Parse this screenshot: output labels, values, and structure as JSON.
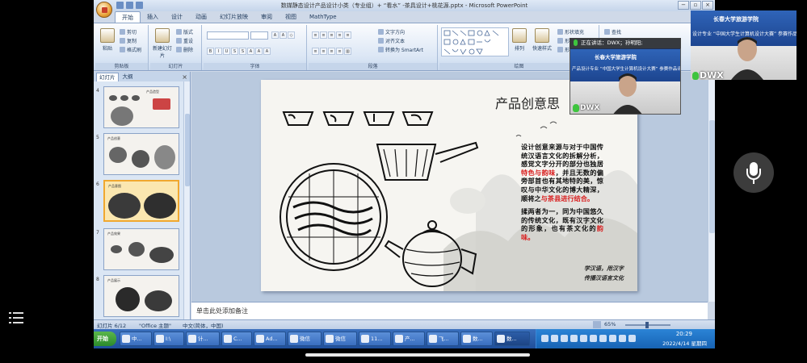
{
  "window": {
    "title": "数媒静态设计产品设计小类（专业组）+ “看水” -茶具设计+桃花源.pptx - Microsoft PowerPoint",
    "controls": [
      "−",
      "▫",
      "×"
    ]
  },
  "ribbon": {
    "tabs": [
      "开始",
      "插入",
      "设计",
      "动画",
      "幻灯片放映",
      "审阅",
      "视图",
      "MathType"
    ],
    "active_tab": "开始",
    "groups": {
      "clipboard": {
        "label": "剪贴板",
        "paste": "粘贴",
        "cut": "剪切",
        "copy": "复制",
        "format_painter": "格式刷"
      },
      "slides": {
        "label": "幻灯片",
        "new_slide": "新建幻灯片",
        "layout": "版式",
        "reset": "重设",
        "delete": "删除"
      },
      "font": {
        "label": "字体"
      },
      "paragraph": {
        "label": "段落",
        "text_direction": "文字方向",
        "align_text": "对齐文本",
        "smartart": "转换为 SmartArt"
      },
      "drawing": {
        "label": "绘图",
        "arrange": "排列",
        "quick_styles": "快速样式",
        "shape_fill": "形状填充",
        "shape_outline": "形状轮廓",
        "shape_effects": "形状效果"
      },
      "editing": {
        "find": "查找"
      }
    }
  },
  "slides_pane": {
    "tabs": [
      "幻灯片",
      "大纲"
    ],
    "close": "×",
    "thumbnails": [
      {
        "num": "4",
        "title": "产品造型",
        "selected": false
      },
      {
        "num": "5",
        "title": "产品创意",
        "selected": false
      },
      {
        "num": "6",
        "title": "产品意图",
        "selected": true
      },
      {
        "num": "7",
        "title": "产品效果",
        "selected": false
      },
      {
        "num": "8",
        "title": "产品展示",
        "selected": false
      }
    ]
  },
  "slide": {
    "title": "产品创意思",
    "body": {
      "p1_a": "设计创意来源与对于中国传统汉语言文化的拆解分析，感觉文字分开的部分也独居",
      "p1_red1": "特色与韵味",
      "p1_b": "，并且无数的偏旁部首也有其地特的美，惊叹与中华文化的博大精深，顺将之",
      "p1_red2": "与茶县进行结合。",
      "p2_a": "揉两者为一，同为中国悠久的传统文化，既有汉字文化的形象，也有茶文化的",
      "p2_red": "韵味。"
    },
    "slogan_line1": "学汉语，用汉字",
    "slogan_line2": "传播汉语言文化"
  },
  "notes": {
    "placeholder": "单击此处添加备注"
  },
  "statusbar": {
    "slide_counter": "幻灯片 6/12",
    "theme": "\"Office 主题\"",
    "language": "中文(简体，中国)",
    "zoom": "65%"
  },
  "taskbar": {
    "start": "开始",
    "tasks": [
      "中...",
      "I:\\",
      "计...",
      "C...",
      "Ad...",
      "微信",
      "微信",
      "11...",
      "产...",
      "飞...",
      "数...",
      "数..."
    ],
    "active_index": 11,
    "time": "20:29",
    "date": "2022/4/14 星期四"
  },
  "meeting": {
    "speaking_label": "正在讲话：DWX；孙明阳;",
    "participant_large": "DWX",
    "participant_small": "DWX",
    "banner_logo": "长春大学旅游学院",
    "banner_sub": "设计专业 “中国大学生计算机设计大赛” 参赛作品评审",
    "banner_sub_small": "产品设计专业 “中国大学生计算机设计大赛” 参赛作品评审"
  }
}
